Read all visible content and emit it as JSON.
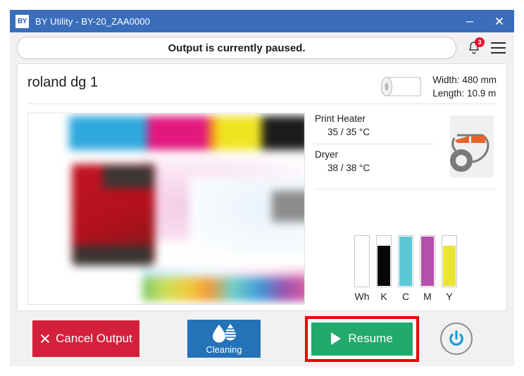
{
  "window": {
    "logo_text": "BY",
    "title": "BY Utility - BY-20_ZAA0000",
    "minimize_label": "minimize",
    "close_label": "close"
  },
  "status": {
    "message": "Output is currently paused.",
    "notification_count": "3"
  },
  "printer": {
    "name": "roland dg 1",
    "media": {
      "width": "Width: 480 mm",
      "length": "Length: 10.9 m"
    }
  },
  "heaters": [
    {
      "label": "Print Heater",
      "value": "35 / 35 °C"
    },
    {
      "label": "Dryer",
      "value": "38 / 38 °C"
    }
  ],
  "inks": [
    {
      "name": "Wh",
      "level": 0,
      "color": "#ffffff"
    },
    {
      "name": "K",
      "level": 82,
      "color": "#080808"
    },
    {
      "name": "C",
      "level": 100,
      "color": "#5bc8d8"
    },
    {
      "name": "M",
      "level": 100,
      "color": "#b44fae"
    },
    {
      "name": "Y",
      "level": 82,
      "color": "#e9e531"
    }
  ],
  "buttons": {
    "cancel": "Cancel Output",
    "cleaning": "Cleaning",
    "resume": "Resume"
  },
  "colors": {
    "titlebar": "#3a6ebb",
    "cancel": "#d4203c",
    "cleaning": "#2472b8",
    "resume": "#22a96c",
    "badge": "#e8112d",
    "highlight": "#ee0000",
    "power": "#1a9ad6"
  }
}
